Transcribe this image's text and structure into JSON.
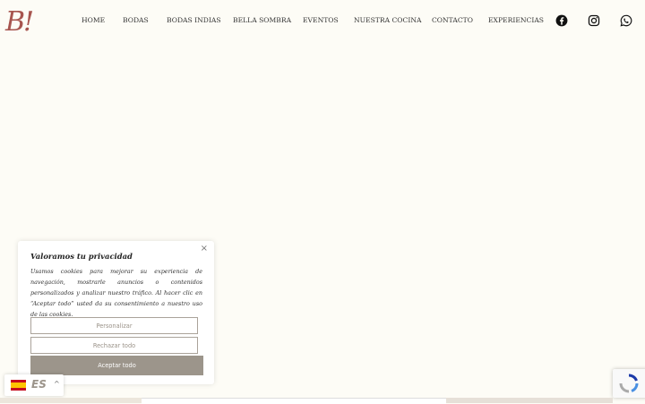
{
  "header": {
    "logo_text": "B!",
    "nav": [
      "HOME",
      "BODAS",
      "BODAS INDIAS",
      "BELLA SOMBRA",
      "EVENTOS",
      "NUESTRA COCINA",
      "CONTACTO",
      "EXPERIENCIAS"
    ],
    "social_icons": [
      "facebook-icon",
      "instagram-icon",
      "whatsapp-icon"
    ]
  },
  "cookie": {
    "title": "Valoramos tu privacidad",
    "text": "Usamos cookies para mejorar su experiencia de navegación, mostrarle anuncios o contenidos personalizados y analizar nuestro tráfico. Al hacer clic en “Aceptar todo” usted da su consentimiento a nuestro uso de las cookies.",
    "close": "×",
    "buttons": {
      "customize": "Personalizar",
      "reject": "Rechazar todo",
      "accept": "Aceptar todo"
    }
  },
  "language": {
    "label": "ES",
    "caret": "^"
  },
  "colors": {
    "background": "#fdfcf6",
    "logo": "#a7554f",
    "accept_button": "#9c958b"
  }
}
